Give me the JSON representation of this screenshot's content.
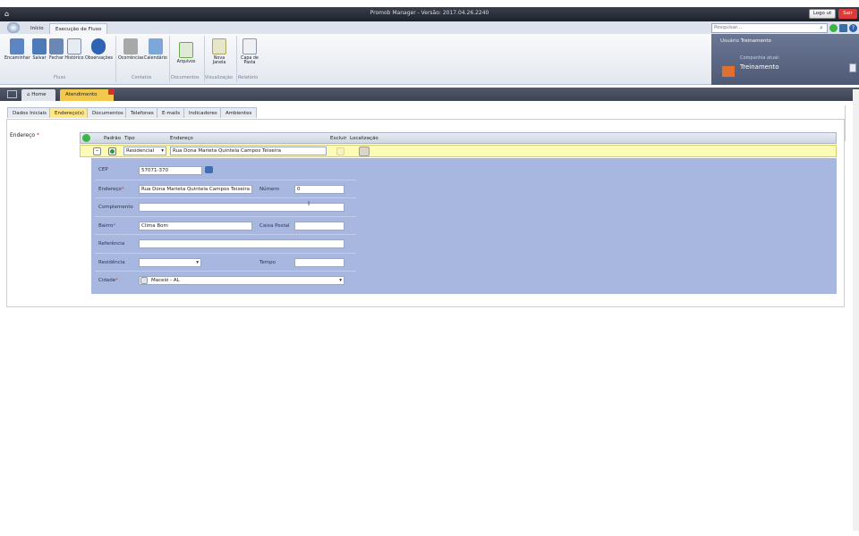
{
  "titlebar": {
    "title": "Promob Manager - Versão: 2017.04.26.2240",
    "logout_label": "Logo ut",
    "exit_label": "Sair"
  },
  "menubar": {
    "tabs": [
      "Início",
      "Execução de Fluxo"
    ],
    "search_placeholder": "Pesquisar..."
  },
  "ribbon": {
    "fluxo": [
      "Encaminhar",
      "Salvar",
      "Fechar",
      "Histórico",
      "Observações"
    ],
    "contatos": [
      "Ocorrências",
      "Calendário"
    ],
    "documentos": [
      "Arquivos"
    ],
    "visualizacao": [
      "Nova Janela"
    ],
    "relatorio": [
      "Capa de Pasta"
    ],
    "groups": [
      "Fluxo",
      "Contatos",
      "Documentos",
      "Visualização",
      "Relatório"
    ]
  },
  "userpanel": {
    "user_label": "Usuário",
    "user_name": "Treinamento",
    "company_label": "Companhia atual:",
    "company_name": "Treinamento"
  },
  "doctabs": [
    "Home",
    "Atendimento"
  ],
  "subtabs": [
    "Dados Iniciais",
    "Endereço(s)",
    "Documentos",
    "Telefones",
    "E-mails",
    "Indicadores",
    "Ambientes"
  ],
  "observacoes_label": "Observações",
  "form": {
    "endereco_label": "Endereço",
    "grid_headers": {
      "padrao": "Padrão",
      "tipo": "Tipo",
      "endereco": "Endereço",
      "excluir": "Excluir",
      "localizacao": "Localização"
    },
    "row": {
      "tipo": "Residencial",
      "endereco": "Rua Dona Marieta Quintela Campos Teixeira"
    },
    "fields": {
      "cep_label": "CEP",
      "cep_value": "57071-370",
      "endereco_label": "Endereço",
      "endereco_value": "Rua Dona Marieta Quintela Campos Teixeira",
      "numero_label": "Número",
      "numero_value": "0",
      "complemento_label": "Complemento",
      "complemento_value": "",
      "bairro_label": "Bairro",
      "bairro_value": "Clima Bom",
      "caixa_label": "Caixa Postal",
      "caixa_value": "",
      "referencia_label": "Referência",
      "referencia_value": "",
      "residencia_label": "Residência",
      "residencia_value": "",
      "tempo_label": "Tempo",
      "tempo_value": "",
      "cidade_label": "Cidade",
      "cidade_value": "Maceió - AL"
    }
  }
}
